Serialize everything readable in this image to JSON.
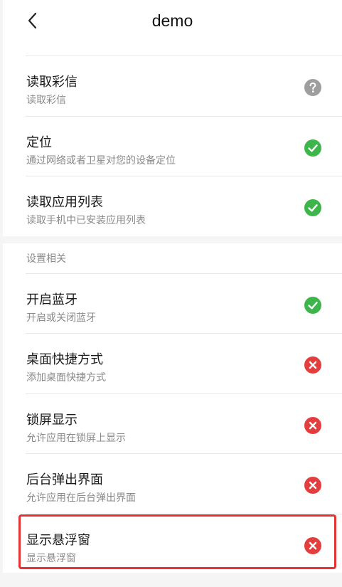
{
  "header": {
    "title": "demo",
    "back_icon": "chevron-left-icon"
  },
  "section1": {
    "items": [
      {
        "title": "读取彩信",
        "subtitle": "读取彩信",
        "status": "unknown",
        "icon": "question-icon"
      },
      {
        "title": "定位",
        "subtitle": "通过网络或者卫星对您的设备定位",
        "status": "granted",
        "icon": "check-icon"
      },
      {
        "title": "读取应用列表",
        "subtitle": "读取手机中已安装应用列表",
        "status": "granted",
        "icon": "check-icon"
      }
    ]
  },
  "section2": {
    "label": "设置相关",
    "items": [
      {
        "title": "开启蓝牙",
        "subtitle": "开启或关闭蓝牙",
        "status": "granted",
        "icon": "check-icon"
      },
      {
        "title": "桌面快捷方式",
        "subtitle": "添加桌面快捷方式",
        "status": "denied",
        "icon": "close-icon"
      },
      {
        "title": "锁屏显示",
        "subtitle": "允许应用在锁屏上显示",
        "status": "denied",
        "icon": "close-icon"
      },
      {
        "title": "后台弹出界面",
        "subtitle": "允许应用在后台弹出界面",
        "status": "denied",
        "icon": "close-icon"
      },
      {
        "title": "显示悬浮窗",
        "subtitle": "显示悬浮窗",
        "status": "denied",
        "icon": "close-icon"
      }
    ]
  },
  "colors": {
    "granted": "#3cb54a",
    "denied": "#e33d3d",
    "unknown": "#9e9e9e",
    "highlight": "#e53232"
  }
}
